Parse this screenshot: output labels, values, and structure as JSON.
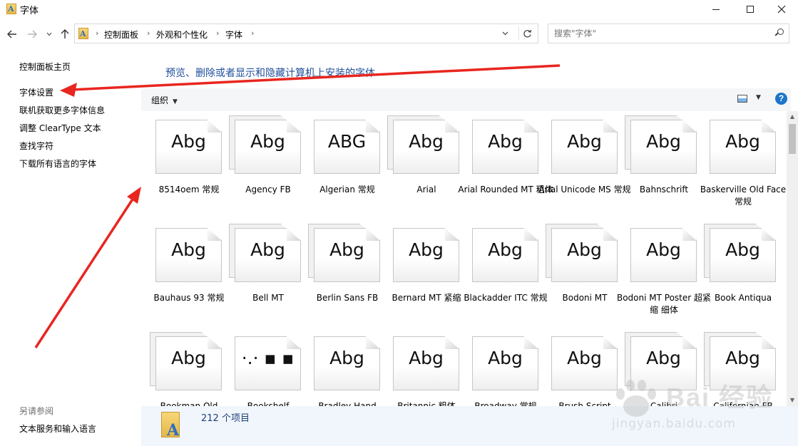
{
  "window": {
    "title": "字体",
    "app_icon_glyph": "A",
    "controls": [
      "minimize-icon",
      "maximize-icon",
      "close-icon"
    ]
  },
  "address": {
    "crumbs": [
      "控制面板",
      "外观和个性化",
      "字体"
    ],
    "search_placeholder": "搜索\"字体\""
  },
  "sidebar": {
    "links": [
      "控制面板主页",
      "字体设置",
      "联机获取更多字体信息",
      "调整 ClearType 文本",
      "查找字符",
      "下载所有语言的字体"
    ],
    "see_also_title": "另请参阅",
    "see_also_links": [
      "文本服务和输入语言"
    ]
  },
  "main": {
    "heading": "预览、删除或者显示和隐藏计算机上安装的字体",
    "organize_label": "组织",
    "help_glyph": "?"
  },
  "fonts": [
    {
      "name": "8514oem 常规",
      "sample": "Abg",
      "stacked": false
    },
    {
      "name": "Agency FB",
      "sample": "Abg",
      "stacked": true
    },
    {
      "name": "Algerian 常规",
      "sample": "ABG",
      "stacked": false
    },
    {
      "name": "Arial",
      "sample": "Abg",
      "stacked": true
    },
    {
      "name": "Arial Rounded MT 粗体",
      "sample": "Abg",
      "stacked": false
    },
    {
      "name": "Arial Unicode MS 常规",
      "sample": "Abg",
      "stacked": false
    },
    {
      "name": "Bahnschrift",
      "sample": "Abg",
      "stacked": true
    },
    {
      "name": "Baskerville Old Face 常规",
      "sample": "Abg",
      "stacked": false
    },
    {
      "name": "Bauhaus 93 常规",
      "sample": "Abg",
      "stacked": false
    },
    {
      "name": "Bell MT",
      "sample": "Abg",
      "stacked": true
    },
    {
      "name": "Berlin Sans FB",
      "sample": "Abg",
      "stacked": true
    },
    {
      "name": "Bernard MT 紧缩",
      "sample": "Abg",
      "stacked": false
    },
    {
      "name": "Blackadder ITC 常规",
      "sample": "Abg",
      "stacked": false
    },
    {
      "name": "Bodoni MT",
      "sample": "Abg",
      "stacked": true
    },
    {
      "name": "Bodoni MT Poster 超紧缩 细体",
      "sample": "Abg",
      "stacked": false
    },
    {
      "name": "Book Antiqua",
      "sample": "Abg",
      "stacked": true
    },
    {
      "name": "Bookman Old",
      "sample": "Abg",
      "stacked": true
    },
    {
      "name": "Bookshelf",
      "sample": "·.· ▪ ▪",
      "stacked": false
    },
    {
      "name": "Bradley Hand",
      "sample": "Abg",
      "stacked": false
    },
    {
      "name": "Britannic 粗体",
      "sample": "Abg",
      "stacked": false
    },
    {
      "name": "Broadway 常规",
      "sample": "Abg",
      "stacked": false
    },
    {
      "name": "Brush Script",
      "sample": "Abg",
      "stacked": false
    },
    {
      "name": "Calibri",
      "sample": "Abg",
      "stacked": true
    },
    {
      "name": "Californian FB",
      "sample": "Abg",
      "stacked": true
    }
  ],
  "status": {
    "item_count": "212 个项目"
  },
  "watermark": {
    "text": "Bai 经验",
    "url": "jingyan.baidu.com"
  },
  "annotation": {
    "color": "#e8261f"
  }
}
